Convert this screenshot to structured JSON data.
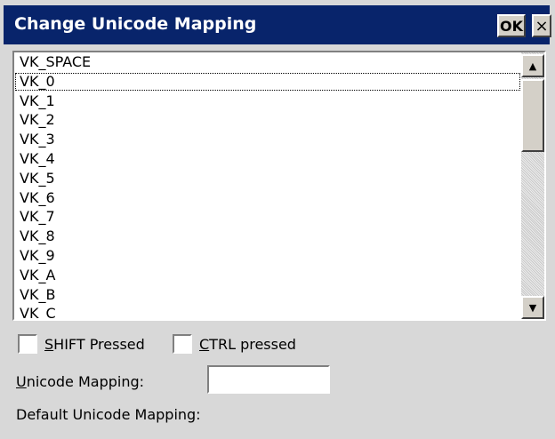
{
  "window": {
    "title": "Change Unicode Mapping",
    "ok_label": "OK",
    "close_label": "×"
  },
  "list": {
    "items": [
      "VK_SPACE",
      "VK_0",
      "VK_1",
      "VK_2",
      "VK_3",
      "VK_4",
      "VK_5",
      "VK_6",
      "VK_7",
      "VK_8",
      "VK_9",
      "VK_A",
      "VK_B",
      "VK_C"
    ],
    "selected": "VK_0"
  },
  "options": {
    "shift_mnemonic": "S",
    "shift_rest": "HIFT Pressed",
    "shift_checked": false,
    "ctrl_mnemonic": "C",
    "ctrl_rest": "TRL pressed",
    "ctrl_checked": false
  },
  "unicode_mapping": {
    "label_mnemonic": "U",
    "label_rest": "nicode Mapping:",
    "value": ""
  },
  "default_unicode_mapping": {
    "label": "Default Unicode Mapping:"
  },
  "colors": {
    "titlebar": "#08246b",
    "dialog_bg": "#d8d8d8"
  }
}
